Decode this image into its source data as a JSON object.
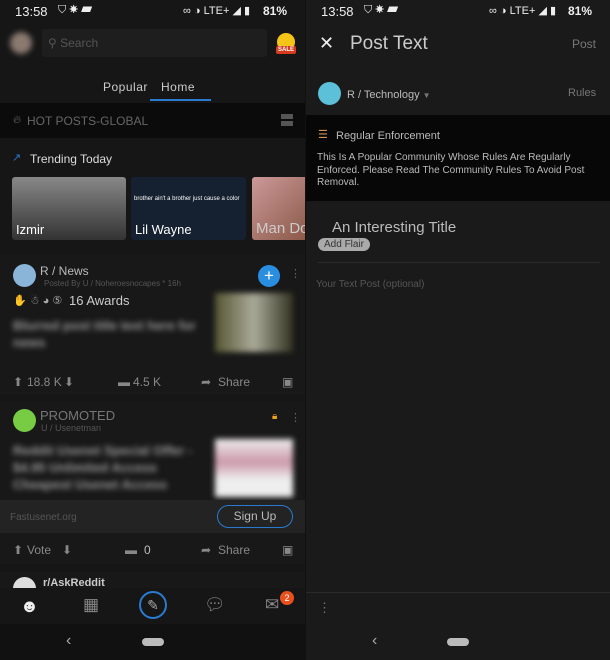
{
  "status": {
    "time": "13:58",
    "network": "LTE+",
    "battery": "81%"
  },
  "left": {
    "search_placeholder": "Search",
    "sale_badge": "SALE",
    "tabs": [
      {
        "label": "Popular"
      },
      {
        "label": "Home",
        "active": true
      }
    ],
    "feed_filter": "HOT POSTS-GLOBAL",
    "trending_title": "Trending Today",
    "trending_cards": [
      {
        "label": "Izmir"
      },
      {
        "label": "Lil Wayne",
        "tweet": "brother ain't a brother just cause a color"
      },
      {
        "label": "Man Do"
      }
    ],
    "post1": {
      "community": "R / News",
      "meta": "Posted By U / Noheroesnocapes * 16h",
      "awards": "16 Awards",
      "title": "Blurred post title text here for news",
      "votes": "18.8 K",
      "comments": "4.5 K",
      "share": "Share"
    },
    "promo": {
      "label": "PROMOTED",
      "user": "U / Usenetman",
      "title": "Reddit Usenet Special Offer - $4.95 Unlimited Access Cheapest Usenet Access",
      "domain": "Fastusenet.org",
      "cta": "Sign Up",
      "vote": "Vote",
      "comments": "0",
      "share": "Share"
    },
    "post3": {
      "community": "r/AskReddit"
    },
    "bottom_nav": [
      "home",
      "communities",
      "create",
      "chat",
      "inbox"
    ],
    "inbox_badge": "2",
    "accent": "#0079d3"
  },
  "right": {
    "title": "Post Text",
    "post_button": "Post",
    "community": "R / Technology",
    "rules": "Rules",
    "notice_title": "Regular Enforcement",
    "notice_body": "This Is A Popular Community Whose Rules Are Regularly Enforced. Please Read The Community Rules To Avoid Post Removal.",
    "title_placeholder": "An Interesting Title",
    "flair": "Add Flair",
    "body_placeholder": "Your Text Post (optional)"
  }
}
